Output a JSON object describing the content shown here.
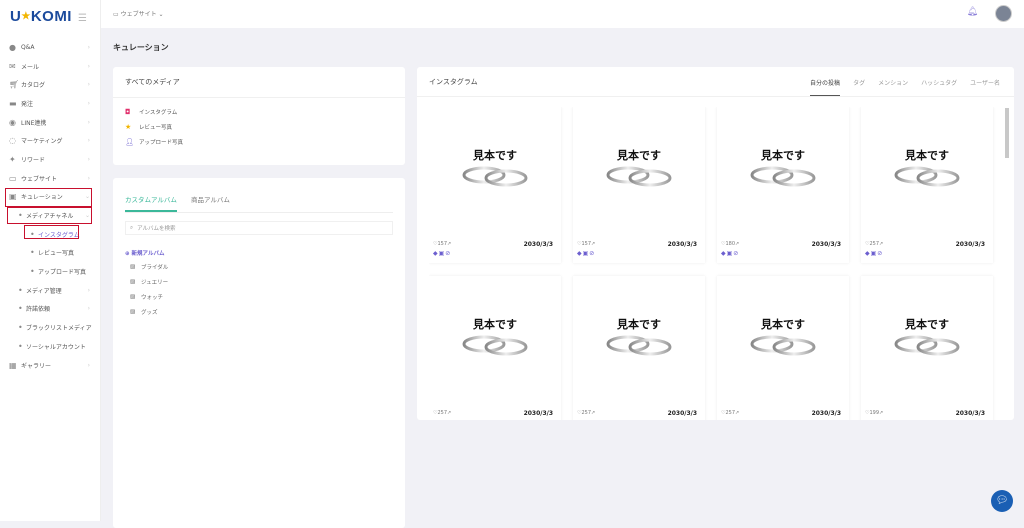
{
  "logo": "U★KOMI",
  "sidebar": {
    "items": [
      {
        "label": "Q&A",
        "icon": "chat-icon"
      },
      {
        "label": "メール",
        "icon": "mail-icon"
      },
      {
        "label": "カタログ",
        "icon": "cart-icon"
      },
      {
        "label": "発注",
        "icon": "truck-icon"
      },
      {
        "label": "LINE連携",
        "icon": "line-icon"
      },
      {
        "label": "マーケティング",
        "icon": "megaphone-icon"
      },
      {
        "label": "リワード",
        "icon": "gift-icon"
      },
      {
        "label": "ウェブサイト",
        "icon": "window-icon"
      },
      {
        "label": "キュレーション",
        "icon": "image-icon"
      },
      {
        "label": "メディアチャネル"
      },
      {
        "label": "インスタグラム"
      },
      {
        "label": "レビュー写真"
      },
      {
        "label": "アップロード写真"
      },
      {
        "label": "メディア管理"
      },
      {
        "label": "許諾依頼"
      },
      {
        "label": "ブラックリストメディア"
      },
      {
        "label": "ソーシャルアカウント"
      },
      {
        "label": "ギャラリー",
        "icon": "grid-icon"
      }
    ]
  },
  "topbar": {
    "breadcrumb": "ウェブサイト"
  },
  "page_title": "キュレーション",
  "media": {
    "title": "すべてのメディア",
    "items": [
      "インスタグラム",
      "レビュー写真",
      "アップロード写真"
    ]
  },
  "albums": {
    "tabs": [
      "カスタムアルバム",
      "商品アルバム"
    ],
    "search_placeholder": "アルバムを検索",
    "new_album": "新規アルバム",
    "items": [
      "ブライダル",
      "ジュエリー",
      "ウォッチ",
      "グッズ"
    ]
  },
  "instagram": {
    "title": "インスタグラム",
    "tabs": [
      "自分の投稿",
      "タグ",
      "メンション",
      "ハッシュタグ",
      "ユーザー名"
    ],
    "posts": [
      {
        "likes": "157",
        "date": "2030/3/3",
        "image_text": "見本です"
      },
      {
        "likes": "157",
        "date": "2030/3/3",
        "image_text": "見本です"
      },
      {
        "likes": "180",
        "date": "2030/3/3",
        "image_text": "見本です"
      },
      {
        "likes": "257",
        "date": "2030/3/3",
        "image_text": "見本です"
      },
      {
        "likes": "257",
        "date": "2030/3/3",
        "image_text": "見本です"
      },
      {
        "likes": "257",
        "date": "2030/3/3",
        "image_text": "見本です"
      },
      {
        "likes": "257",
        "date": "2030/3/3",
        "image_text": "見本です"
      },
      {
        "likes": "199",
        "date": "2030/3/3",
        "image_text": "見本です"
      }
    ]
  },
  "colors": {
    "accent": "#3bb89a",
    "brand": "#1b4a9c",
    "highlight": "#c8102e",
    "purple": "#6c5fcf"
  }
}
